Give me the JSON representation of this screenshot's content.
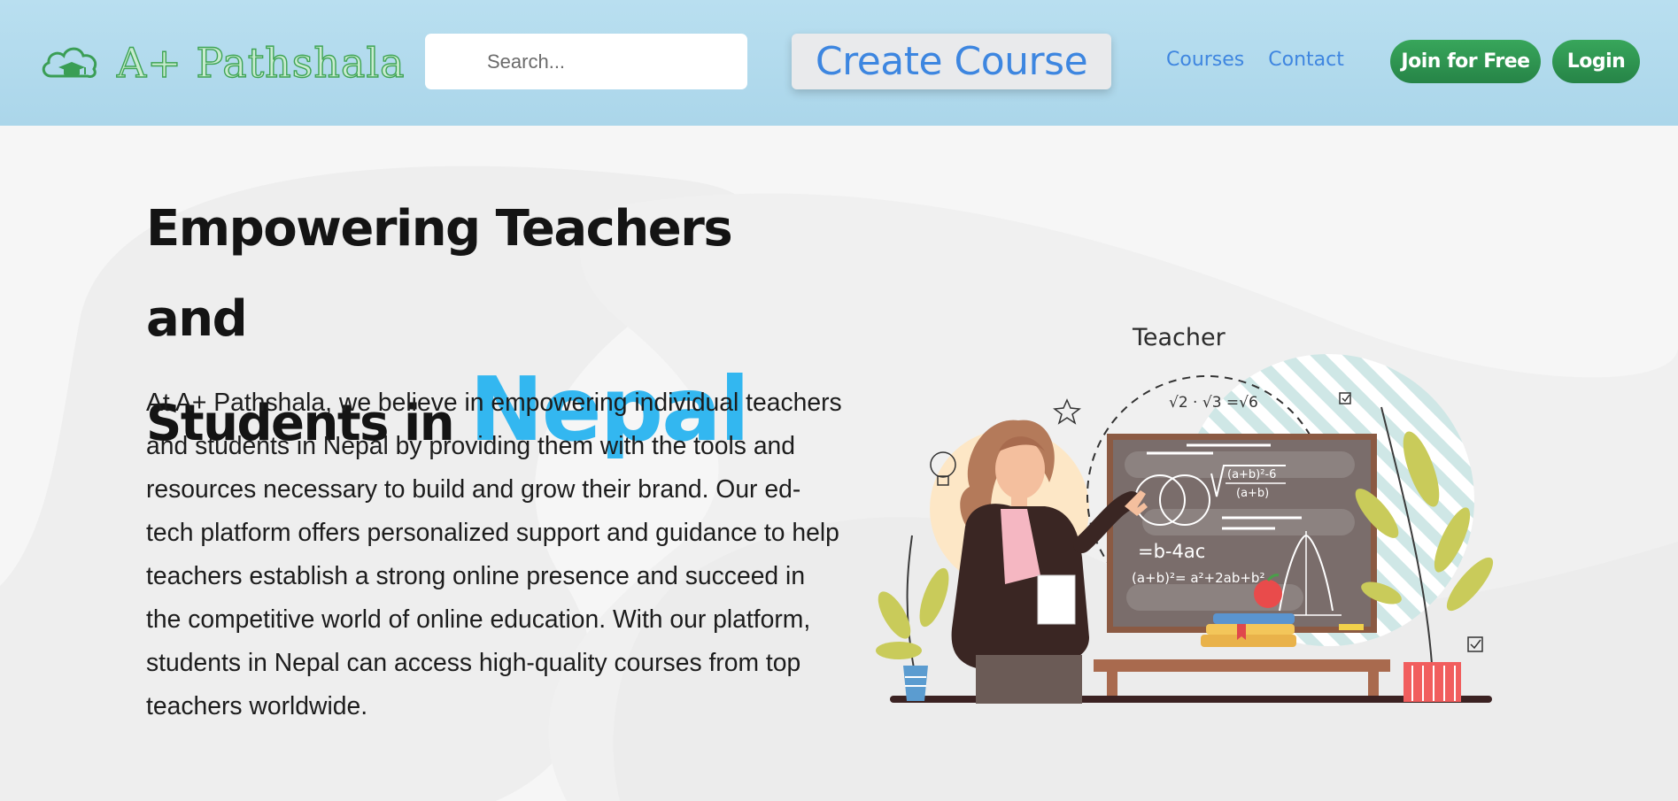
{
  "header": {
    "logo_text": "A+ Pathshala",
    "search_placeholder": "Search...",
    "create_course_label": "Create Course",
    "nav": [
      {
        "label": "Courses"
      },
      {
        "label": "Contact"
      }
    ],
    "join_label": "Join for Free",
    "login_label": "Login"
  },
  "hero": {
    "headline_line1": "Empowering Teachers and",
    "headline_line2_prefix": "Students in",
    "headline_accent": "Nepal",
    "description": "At A+ Pathshala, we believe in empowering individual teachers and students in Nepal by providing them with the tools and resources necessary to build and grow their brand. Our ed-tech platform offers personalized support and guidance to help teachers establish a strong online presence and succeed in the competitive world of online education. With our platform, students in Nepal can access high-quality courses from top teachers worldwide.",
    "illustration": {
      "caption": "Teacher",
      "board_formula_top": "√2 · √3 =√6",
      "board_formula_fraction_num": "(a+b)²-6",
      "board_formula_fraction_den": "(a+b)",
      "board_formula_mid": "=b-4ac",
      "board_formula_expand": "(a+b)²= a²+2ab+b²"
    }
  },
  "colors": {
    "header_bg": "#b9dff0",
    "brand_green": "#2f9a52",
    "link_blue": "#3f86e0",
    "accent_blue": "#33b7f0"
  }
}
